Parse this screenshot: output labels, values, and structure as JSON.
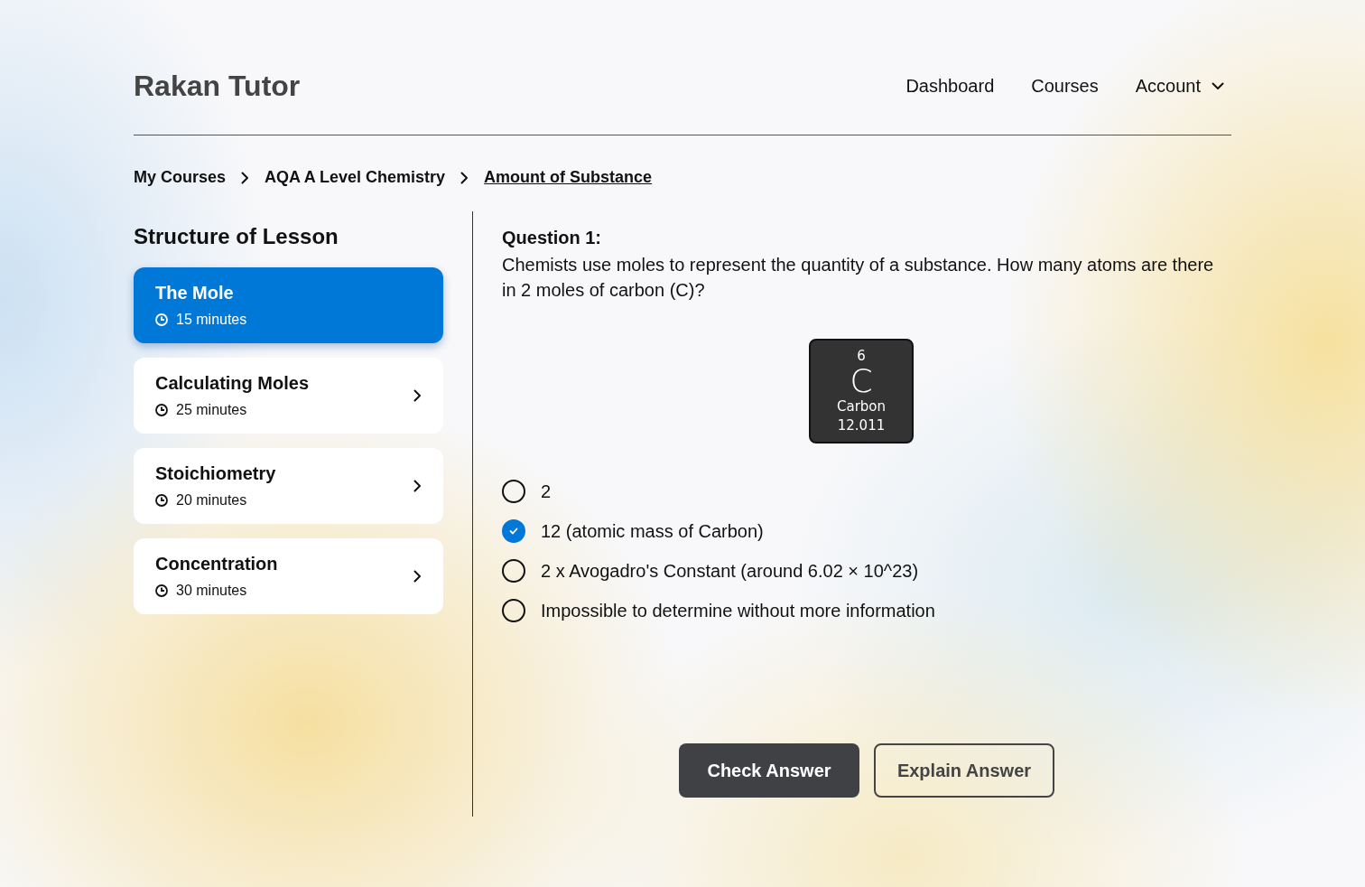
{
  "brand": "Rakan Tutor",
  "nav": [
    {
      "label": "Dashboard",
      "kind": "link"
    },
    {
      "label": "Courses",
      "kind": "link"
    },
    {
      "label": "Account",
      "kind": "menu"
    }
  ],
  "breadcrumb": [
    {
      "label": "My Courses",
      "current": false
    },
    {
      "label": "AQA A Level Chemistry",
      "current": false
    },
    {
      "label": "Amount of Substance",
      "current": true
    }
  ],
  "sidebar": {
    "title": "Structure of Lesson",
    "items": [
      {
        "title": "The Mole",
        "duration": "15 minutes",
        "selected": true
      },
      {
        "title": "Calculating Moles",
        "duration": "25 minutes",
        "selected": false
      },
      {
        "title": "Stoichiometry",
        "duration": "20 minutes",
        "selected": false
      },
      {
        "title": "Concentration",
        "duration": "30 minutes",
        "selected": false
      }
    ]
  },
  "question": {
    "heading": "Question 1:",
    "text": "Chemists use moles to represent the quantity of a substance. How many atoms are there in 2 moles of carbon (C)?",
    "element_tile": {
      "number": "6",
      "symbol": "C",
      "name": "Carbon",
      "mass": "12.011"
    },
    "options": [
      {
        "label": "2",
        "selected": false
      },
      {
        "label": "12 (atomic mass of Carbon)",
        "selected": true
      },
      {
        "label": "2 x Avogadro's Constant (around 6.02 × 10^23)",
        "selected": false
      },
      {
        "label": "Impossible to determine without more information",
        "selected": false
      }
    ],
    "buttons": [
      {
        "label": "Check Answer",
        "kind": "primary"
      },
      {
        "label": "Explain Answer",
        "kind": "secondary"
      }
    ]
  }
}
